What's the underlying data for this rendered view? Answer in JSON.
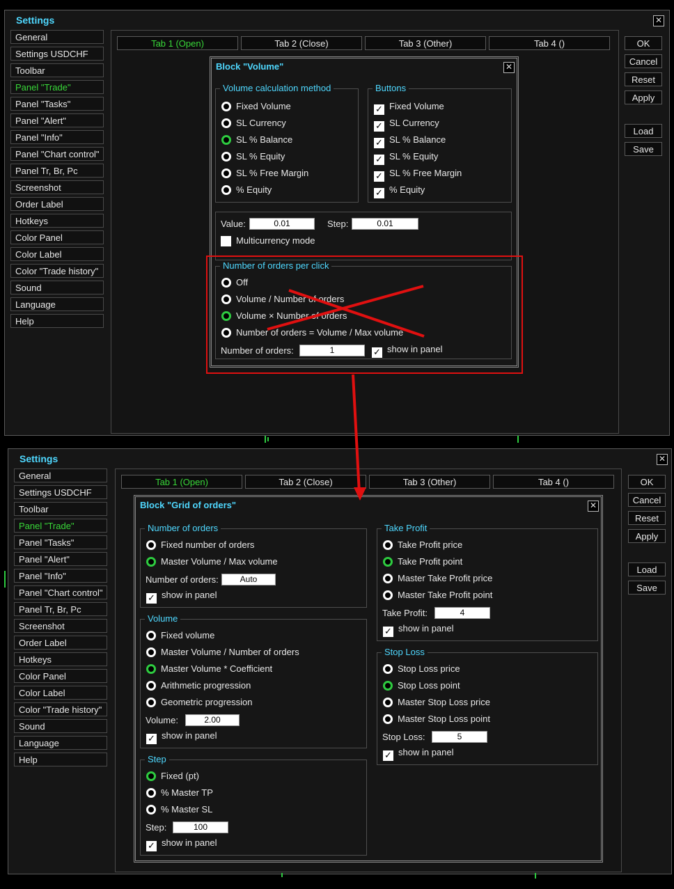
{
  "window1": {
    "title": "Settings",
    "close_glyph": "✕",
    "sidebar": [
      "General",
      "Settings USDCHF",
      "Toolbar",
      "Panel \"Trade\"",
      "Panel \"Tasks\"",
      "Panel \"Alert\"",
      "Panel \"Info\"",
      "Panel \"Chart control\"",
      "Panel Tr, Br, Pc",
      "Screenshot",
      "Order Label",
      "Hotkeys",
      "Color Panel",
      "Color Label",
      "Color \"Trade history\"",
      "Sound",
      "Language",
      "Help"
    ],
    "tabs": [
      "Tab 1 (Open)",
      "Tab 2 (Close)",
      "Tab 3 (Other)",
      "Tab 4 ()"
    ],
    "buttons": {
      "ok": "OK",
      "cancel": "Cancel",
      "reset": "Reset",
      "apply": "Apply",
      "load": "Load",
      "save": "Save"
    },
    "dialog": {
      "title": "Block \"Volume\"",
      "method_title": "Volume calculation method",
      "methods": [
        "Fixed Volume",
        "SL Currency",
        "SL % Balance",
        "SL % Equity",
        "SL % Free Margin",
        "% Equity"
      ],
      "buttons_title": "Buttons",
      "button_items": [
        "Fixed Volume",
        "SL Currency",
        "SL % Balance",
        "SL % Equity",
        "SL % Free Margin",
        "% Equity"
      ],
      "value_label": "Value:",
      "value": "0.01",
      "step_label": "Step:",
      "step": "0.01",
      "multicurrency": "Multicurrency mode",
      "orders_title": "Number of orders per click",
      "orders_options": [
        "Off",
        "Volume / Number of orders",
        "Volume × Number of orders",
        "Number of orders = Volume / Max volume"
      ],
      "orders_label": "Number of orders:",
      "orders_value": "1",
      "show_in_panel": "show in panel"
    }
  },
  "window2": {
    "title": "Settings",
    "dialog": {
      "title": "Block \"Grid of orders\"",
      "orders_title": "Number of orders",
      "orders_options": [
        "Fixed number of orders",
        "Master Volume / Max volume"
      ],
      "orders_label": "Number of orders:",
      "orders_value": "Auto",
      "volume_title": "Volume",
      "volume_options": [
        "Fixed volume",
        "Master Volume / Number of orders",
        "Master Volume * Coefficient",
        "Arithmetic progression",
        "Geometric progression"
      ],
      "volume_label": "Volume:",
      "volume_value": "2.00",
      "step_title": "Step",
      "step_options": [
        "Fixed (pt)",
        "% Master TP",
        "% Master SL"
      ],
      "step_label": "Step:",
      "step_value": "100",
      "tp_title": "Take Profit",
      "tp_options": [
        "Take Profit price",
        "Take Profit point",
        "Master Take Profit price",
        "Master Take Profit point"
      ],
      "tp_label": "Take Profit:",
      "tp_value": "4",
      "sl_title": "Stop Loss",
      "sl_options": [
        "Stop Loss price",
        "Stop Loss point",
        "Master Stop Loss price",
        "Master Stop Loss point"
      ],
      "sl_label": "Stop Loss:",
      "sl_value": "5",
      "show_in_panel": "show in panel"
    }
  },
  "colors": {
    "accent": "#4fd8ff",
    "active": "#39d839",
    "highlight": "#e01010"
  }
}
